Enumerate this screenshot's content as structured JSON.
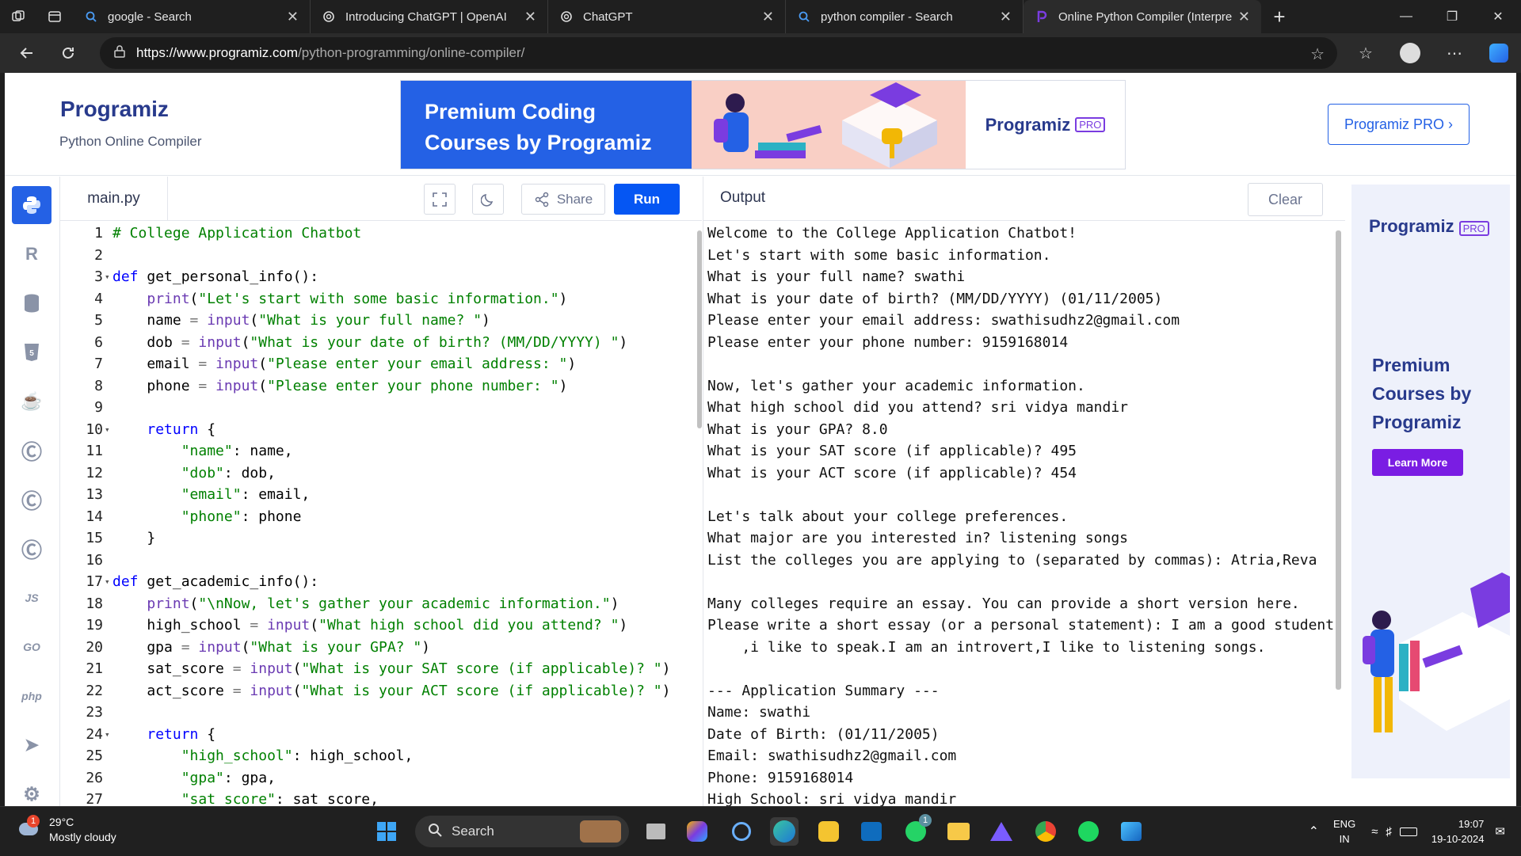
{
  "browser": {
    "tabs": [
      {
        "title": "google - Search",
        "icon": "search-icon",
        "active": false
      },
      {
        "title": "Introducing ChatGPT | OpenAI",
        "icon": "openai-icon",
        "active": false
      },
      {
        "title": "ChatGPT",
        "icon": "openai-icon",
        "active": false
      },
      {
        "title": "python compiler - Search",
        "icon": "search-icon",
        "active": false
      },
      {
        "title": "Online Python Compiler (Interpre",
        "icon": "programiz-icon",
        "active": true
      }
    ],
    "url_host": "https://www.programiz.com",
    "url_path": "/python-programming/online-compiler/"
  },
  "header": {
    "logo": "Programiz",
    "subtitle": "Python Online Compiler",
    "banner_title_1": "Premium Coding",
    "banner_title_2": "Courses by Programiz",
    "banner_logo": "Programiz",
    "banner_pro": "PRO",
    "pro_button": "Programiz PRO ›"
  },
  "sidenav": [
    "python",
    "r",
    "sql",
    "html",
    "java",
    "c",
    "cpp",
    "csharp",
    "JS",
    "GO",
    "php",
    "swift",
    "rust"
  ],
  "editor": {
    "filename": "main.py",
    "share_label": "Share",
    "run_label": "Run",
    "lines": [
      {
        "n": "1",
        "fold": false,
        "code": "# College Application Chatbot"
      },
      {
        "n": "2",
        "fold": false,
        "code": ""
      },
      {
        "n": "3",
        "fold": true,
        "code": "def get_personal_info():"
      },
      {
        "n": "4",
        "fold": false,
        "code": "    print(\"Let's start with some basic information.\")"
      },
      {
        "n": "5",
        "fold": false,
        "code": "    name = input(\"What is your full name? \")"
      },
      {
        "n": "6",
        "fold": false,
        "code": "    dob = input(\"What is your date of birth? (MM/DD/YYYY) \")"
      },
      {
        "n": "7",
        "fold": false,
        "code": "    email = input(\"Please enter your email address: \")"
      },
      {
        "n": "8",
        "fold": false,
        "code": "    phone = input(\"Please enter your phone number: \")"
      },
      {
        "n": "9",
        "fold": false,
        "code": ""
      },
      {
        "n": "10",
        "fold": true,
        "code": "    return {"
      },
      {
        "n": "11",
        "fold": false,
        "code": "        \"name\": name,"
      },
      {
        "n": "12",
        "fold": false,
        "code": "        \"dob\": dob,"
      },
      {
        "n": "13",
        "fold": false,
        "code": "        \"email\": email,"
      },
      {
        "n": "14",
        "fold": false,
        "code": "        \"phone\": phone"
      },
      {
        "n": "15",
        "fold": false,
        "code": "    }"
      },
      {
        "n": "16",
        "fold": false,
        "code": ""
      },
      {
        "n": "17",
        "fold": true,
        "code": "def get_academic_info():"
      },
      {
        "n": "18",
        "fold": false,
        "code": "    print(\"\\nNow, let's gather your academic information.\")"
      },
      {
        "n": "19",
        "fold": false,
        "code": "    high_school = input(\"What high school did you attend? \")"
      },
      {
        "n": "20",
        "fold": false,
        "code": "    gpa = input(\"What is your GPA? \")"
      },
      {
        "n": "21",
        "fold": false,
        "code": "    sat_score = input(\"What is your SAT score (if applicable)? \")"
      },
      {
        "n": "22",
        "fold": false,
        "code": "    act_score = input(\"What is your ACT score (if applicable)? \")"
      },
      {
        "n": "23",
        "fold": false,
        "code": ""
      },
      {
        "n": "24",
        "fold": true,
        "code": "    return {"
      },
      {
        "n": "25",
        "fold": false,
        "code": "        \"high_school\": high_school,"
      },
      {
        "n": "26",
        "fold": false,
        "code": "        \"gpa\": gpa,"
      },
      {
        "n": "27",
        "fold": false,
        "code": "        \"sat_score\": sat_score,"
      }
    ]
  },
  "output": {
    "title": "Output",
    "clear_label": "Clear",
    "lines": [
      "Welcome to the College Application Chatbot!",
      "Let's start with some basic information.",
      "What is your full name? swathi",
      "What is your date of birth? (MM/DD/YYYY) (01/11/2005)",
      "Please enter your email address: swathisudhz2@gmail.com",
      "Please enter your phone number: 9159168014",
      "",
      "Now, let's gather your academic information.",
      "What high school did you attend? sri vidya mandir",
      "What is your GPA? 8.0",
      "What is your SAT score (if applicable)? 495",
      "What is your ACT score (if applicable)? 454",
      "",
      "Let's talk about your college preferences.",
      "What major are you interested in? listening songs",
      "List the colleges you are applying to (separated by commas): Atria,Reva",
      "",
      "Many colleges require an essay. You can provide a short version here.",
      "Please write a short essay (or a personal statement): I am a good student",
      "    ,i like to speak.I am an introvert,I like to listening songs.",
      "",
      "--- Application Summary ---",
      "Name: swathi",
      "Date of Birth: (01/11/2005)",
      "Email: swathisudhz2@gmail.com",
      "Phone: 9159168014",
      "High School: sri vidya mandir"
    ]
  },
  "ad": {
    "logo": "Programiz",
    "pro": "PRO",
    "title": "Premium Courses by Programiz",
    "button": "Learn More"
  },
  "taskbar": {
    "temp": "29°C",
    "weather": "Mostly cloudy",
    "weather_badge": "1",
    "search": "Search",
    "lang_1": "ENG",
    "lang_2": "IN",
    "time": "19:07",
    "date": "19-10-2024",
    "whatsapp_badge": "1"
  },
  "colors": {
    "accent": "#0556f3",
    "keyword": "#0000ff",
    "string": "#008000",
    "comment": "#008000",
    "pro_purple": "#7a3ce0"
  }
}
